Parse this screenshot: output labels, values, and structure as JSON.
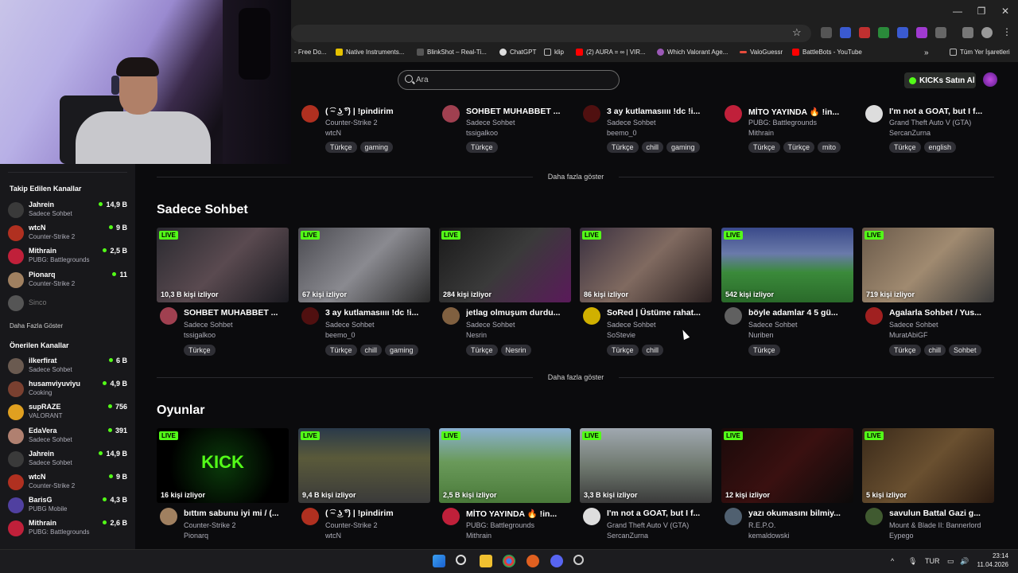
{
  "browser": {
    "bookmarks": [
      {
        "label": "- Free Do...",
        "color": "#c0392b"
      },
      {
        "label": "Native Instruments...",
        "color": "#e6c200"
      },
      {
        "label": "BlinkShot – Real-Ti...",
        "color": "#444"
      },
      {
        "label": "ChatGPT",
        "color": "#dddddd"
      },
      {
        "label": "klip",
        "color": "#bbbbbb"
      },
      {
        "label": "(2) AURA = ∞ | VIR...",
        "color": "#ff0000"
      },
      {
        "label": "Which Valorant Age...",
        "color": "#9b59b6"
      },
      {
        "label": "ValoGuessr",
        "color": "#e74c3c"
      },
      {
        "label": "BattleBots - YouTube",
        "color": "#ff0000"
      }
    ],
    "more_bookmarks": "»",
    "all_bookmarks": "Tüm Yer İşaretleri"
  },
  "header": {
    "search_placeholder": "Ara",
    "kicks_button": "KICKs Satın Al"
  },
  "sidebar": {
    "followed_title": "Takip Edilen Kanallar",
    "followed": [
      {
        "name": "Jahrein",
        "category": "Sadece Sohbet",
        "viewers": "14,9 B",
        "color": "#3a3a3a"
      },
      {
        "name": "wtcN",
        "category": "Counter-Strike 2",
        "viewers": "9 B",
        "color": "#b03020"
      },
      {
        "name": "Mithrain",
        "category": "PUBG: Battlegrounds",
        "viewers": "2,5 B",
        "color": "#c0203a"
      },
      {
        "name": "Pionarq",
        "category": "Counter-Strike 2",
        "viewers": "11",
        "color": "#a08060"
      },
      {
        "name": "Sinco",
        "category": "",
        "viewers": "",
        "color": "#555555"
      }
    ],
    "followed_more": "Daha Fazla Göster",
    "recommended_title": "Önerilen Kanallar",
    "recommended": [
      {
        "name": "ilkerfirat",
        "category": "Sadece Sohbet",
        "viewers": "6 B",
        "color": "#6a5a50"
      },
      {
        "name": "husamviyuviyu",
        "category": "Cooking",
        "viewers": "4,9 B",
        "color": "#7a4030"
      },
      {
        "name": "supRAZE",
        "category": "VALORANT",
        "viewers": "756",
        "color": "#e0a020"
      },
      {
        "name": "EdaVera",
        "category": "Sadece Sohbet",
        "viewers": "391",
        "color": "#b08070"
      },
      {
        "name": "Jahrein",
        "category": "Sadece Sohbet",
        "viewers": "14,9 B",
        "color": "#3a3a3a"
      },
      {
        "name": "wtcN",
        "category": "Counter-Strike 2",
        "viewers": "9 B",
        "color": "#b03020"
      },
      {
        "name": "BarisG",
        "category": "PUBG Mobile",
        "viewers": "4,3 B",
        "color": "#5040a0"
      },
      {
        "name": "Mithrain",
        "category": "PUBG: Battlegrounds",
        "viewers": "2,6 B",
        "color": "#c0203a"
      }
    ]
  },
  "top_row": [
    {
      "title": "( ͡~ ͜ʖ ͡°) | !pindirim",
      "category": "Counter-Strike 2",
      "user": "wtcN",
      "tags": [
        "Türkçe",
        "gaming"
      ],
      "avatar_color": "#b03020"
    },
    {
      "title": "SOHBET MUHABBET ...",
      "category": "Sadece Sohbet",
      "user": "tssigalkoo",
      "tags": [
        "Türkçe"
      ],
      "avatar_color": "#a04050"
    },
    {
      "title": "3 ay kutlamasıııı !dc !i...",
      "category": "Sadece Sohbet",
      "user": "beemo_0",
      "tags": [
        "Türkçe",
        "chill",
        "gaming"
      ],
      "avatar_color": "#501010"
    },
    {
      "title": "MİTO YAYINDA 🔥 !in...",
      "category": "PUBG: Battlegrounds",
      "user": "Mithrain",
      "tags": [
        "Türkçe",
        "Türkçe",
        "mito"
      ],
      "avatar_color": "#c0203a"
    },
    {
      "title": "I'm not a GOAT, but I f...",
      "category": "Grand Theft Auto V (GTA)",
      "user": "SercanZurna",
      "tags": [
        "Türkçe",
        "english"
      ],
      "avatar_color": "#dddddd"
    }
  ],
  "show_more": "Daha fazla göster",
  "section_chat": {
    "title": "Sadece Sohbet",
    "cards": [
      {
        "title": "SOHBET MUHABBET ...",
        "category": "Sadece Sohbet",
        "user": "tssigalkoo",
        "viewers": "10,3 B kişi izliyor",
        "live": "LIVE",
        "tags": [
          "Türkçe"
        ],
        "thumb": "linear-gradient(135deg,#2a2a30,#5a4a50 50%,#1a1a20)",
        "avatar_color": "#a04050"
      },
      {
        "title": "3 ay kutlamasıııı !dc !i...",
        "category": "Sadece Sohbet",
        "user": "beemo_0",
        "viewers": "67 kişi izliyor",
        "live": "LIVE",
        "tags": [
          "Türkçe",
          "chill",
          "gaming"
        ],
        "thumb": "linear-gradient(135deg,#4a4a50,#8a8a90 50%,#2a2a2a)",
        "avatar_color": "#501010"
      },
      {
        "title": "jetlag olmuşum durdu...",
        "category": "Sadece Sohbet",
        "user": "Nesrin",
        "viewers": "284 kişi izliyor",
        "live": "LIVE",
        "tags": [
          "Türkçe",
          "Nesrin"
        ],
        "thumb": "linear-gradient(135deg,#1a1a1a,#3a3a3a 50%,#5a1a5a)",
        "avatar_color": "#806040"
      },
      {
        "title": "SoRed | Üstüme rahat...",
        "category": "Sadece Sohbet",
        "user": "SoStevie",
        "viewers": "86 kişi izliyor",
        "live": "LIVE",
        "tags": [
          "Türkçe",
          "chill"
        ],
        "thumb": "linear-gradient(135deg,#3a3040,#806a60 50%,#2a2020)",
        "avatar_color": "#d0b000"
      },
      {
        "title": "böyle adamlar 4 5 gü...",
        "category": "Sadece Sohbet",
        "user": "Nuriben",
        "viewers": "542 kişi izliyor",
        "live": "LIVE",
        "tags": [
          "Türkçe"
        ],
        "thumb": "linear-gradient(180deg,#3a4a8a,#6a7aaa 35%,#3a8a3a 60%,#2a6a2a)",
        "avatar_color": "#606060"
      },
      {
        "title": "Agalarla Sohbet / Yus...",
        "category": "Sadece Sohbet",
        "user": "MuratAbiGF",
        "viewers": "719 kişi izliyor",
        "live": "LIVE",
        "tags": [
          "Türkçe",
          "chill",
          "Sohbet"
        ],
        "thumb": "linear-gradient(135deg,#6a5a4a,#a08a70 50%,#3a3a3a)",
        "avatar_color": "#a02020"
      }
    ]
  },
  "section_games": {
    "title": "Oyunlar",
    "cards": [
      {
        "title": "bıttım sabunu iyi mi / (...",
        "category": "Counter-Strike 2",
        "user": "Pionarq",
        "viewers": "16 kişi izliyor",
        "live": "LIVE",
        "thumb_text": "KICK",
        "thumb": "radial-gradient(circle,#0a3a0a,#000 70%)",
        "avatar_color": "#a08060"
      },
      {
        "title": "( ͡~ ͜ʖ ͡°) | !pindirim",
        "category": "Counter-Strike 2",
        "user": "wtcN",
        "viewers": "9,4 B kişi izliyor",
        "live": "LIVE",
        "thumb_text": "",
        "thumb": "linear-gradient(180deg,#2a3a4a,#5a5a3a 40%,#3a3a3a)",
        "avatar_color": "#b03020"
      },
      {
        "title": "MİTO YAYINDA 🔥 !in...",
        "category": "PUBG: Battlegrounds",
        "user": "Mithrain",
        "viewers": "2,5 B kişi izliyor",
        "live": "LIVE",
        "thumb_text": "",
        "thumb": "linear-gradient(180deg,#8ab0d0,#6a9a5a 45%,#4a7a3a)",
        "avatar_color": "#c0203a"
      },
      {
        "title": "I'm not a GOAT, but I f...",
        "category": "Grand Theft Auto V (GTA)",
        "user": "SercanZurna",
        "viewers": "3,3 B kişi izliyor",
        "live": "LIVE",
        "thumb_text": "",
        "thumb": "linear-gradient(180deg,#a0a8b0,#707a70 50%,#3a3a3a)",
        "avatar_color": "#dddddd"
      },
      {
        "title": "yazı okumasını bilmiy...",
        "category": "R.E.P.O.",
        "user": "kemaldowski",
        "viewers": "12 kişi izliyor",
        "live": "LIVE",
        "thumb_text": "",
        "thumb": "linear-gradient(135deg,#1a0a0a,#3a1010 50%,#0a0a0a)",
        "avatar_color": "#506070"
      },
      {
        "title": "savulun Battal Gazi g...",
        "category": "Mount & Blade II: Bannerlord",
        "user": "Eypego",
        "viewers": "5 kişi izliyor",
        "live": "LIVE",
        "thumb_text": "",
        "thumb": "linear-gradient(135deg,#3a2a1a,#6a5030 50%,#2a1a10)",
        "avatar_color": "#405a30"
      }
    ]
  },
  "taskbar": {
    "lang": "TUR",
    "time": "23:14",
    "date": "11.04.2026"
  }
}
